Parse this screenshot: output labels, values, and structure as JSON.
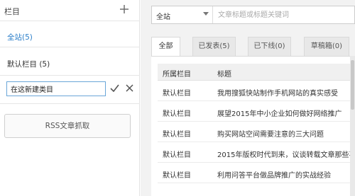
{
  "sidebar": {
    "title": "栏目",
    "categories": [
      {
        "label": "全站(5)"
      },
      {
        "label": "默认栏目 (5)"
      }
    ],
    "new_category_input": {
      "value": "在这新建类目"
    },
    "rss_button": "RSS文章抓取"
  },
  "search": {
    "scope": "全站",
    "placeholder": "文章标题或标题关键词"
  },
  "tabs": [
    {
      "label": "全部"
    },
    {
      "label": "已发表(5)"
    },
    {
      "label": "已下线(0)"
    },
    {
      "label": "草稿箱(0)"
    }
  ],
  "table": {
    "headers": [
      "所属栏目",
      "标题"
    ],
    "rows": [
      {
        "category": "默认栏目",
        "title": "我用搜狐快站制作手机网站的真实感受"
      },
      {
        "category": "默认栏目",
        "title": "展望2015年中小企业如何做好网络推广"
      },
      {
        "category": "默认栏目",
        "title": "购买网站空间需要注意的三大问题"
      },
      {
        "category": "默认栏目",
        "title": "2015年版权时代到来，议谈转载文章那些事"
      },
      {
        "category": "默认栏目",
        "title": "利用问答平台做品牌推广的实战经验"
      }
    ]
  },
  "colors": {
    "accent": "#2a7ec9",
    "confirm": "#2e8b57",
    "panel_bg": "#f2f2f2"
  }
}
